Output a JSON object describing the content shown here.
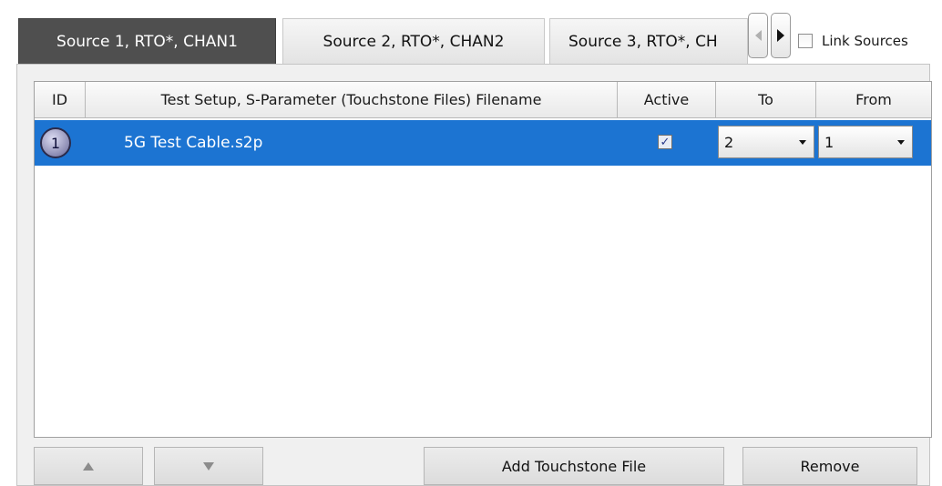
{
  "tabs": [
    {
      "label": "Source 1, RTO*, CHAN1",
      "active": true
    },
    {
      "label": "Source 2, RTO*, CHAN2",
      "active": false
    },
    {
      "label": "Source 3, RTO*, CH",
      "active": false
    }
  ],
  "link_sources": {
    "label": "Link Sources",
    "checked": false
  },
  "table": {
    "columns": {
      "id": "ID",
      "filename": "Test Setup, S-Parameter (Touchstone Files) Filename",
      "active": "Active",
      "to": "To",
      "from": "From"
    },
    "rows": [
      {
        "id": "1",
        "filename": "5G Test Cable.s2p",
        "active": true,
        "to": "2",
        "from": "1"
      }
    ],
    "selected_row_color": "#1c74d2"
  },
  "buttons": {
    "move_up_icon": "triangle-up-icon",
    "move_down_icon": "triangle-down-icon",
    "add": "Add Touchstone File",
    "remove": "Remove"
  },
  "colors": {
    "active_tab": "#4f4f4f",
    "selection": "#1c74d2",
    "panel": "#f0f0f0"
  }
}
